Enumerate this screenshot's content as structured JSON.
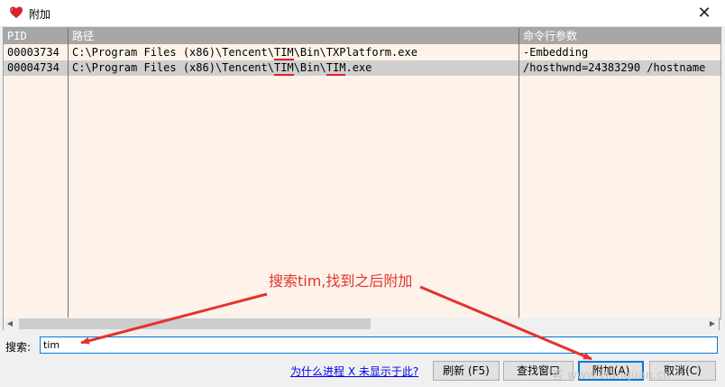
{
  "window": {
    "title": "附加",
    "close_symbol": "✕"
  },
  "table": {
    "columns": [
      "PID",
      "路径",
      "命令行参数"
    ],
    "rows": [
      {
        "pid": "00003734",
        "path": {
          "pre": "C:\\Program Files (x86)\\Tencent\\",
          "hl1": "TIM",
          "mid": "\\Bin\\TXPlatform.exe",
          "hl2": "",
          "post": ""
        },
        "args": "-Embedding",
        "selected": false
      },
      {
        "pid": "00004734",
        "path": {
          "pre": "C:\\Program Files (x86)\\Tencent\\",
          "hl1": "TIM",
          "mid": "\\Bin\\",
          "hl2": "TIM",
          "post": ".exe"
        },
        "args": "/hosthwnd=24383290 /hostname",
        "selected": true
      }
    ]
  },
  "search": {
    "label": "搜索:",
    "value": "tim"
  },
  "footer": {
    "why_link": "为什么进程 X 未显示于此?",
    "refresh_label": "刷新 (F5)",
    "find_window_label": "查找窗口",
    "attach_label": "附加(A)",
    "cancel_label": "取消(C)"
  },
  "annotation": {
    "text": "搜索tim,找到之后附加",
    "color": "#e5322d"
  },
  "watermark": {
    "text": "客  www.vianquan.cn"
  },
  "icons": {
    "app": "heart-icon",
    "close": "close-icon"
  }
}
